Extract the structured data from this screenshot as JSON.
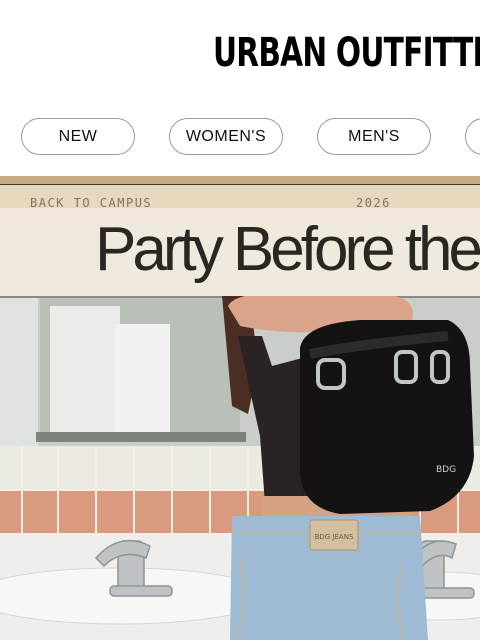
{
  "header": {
    "logo_text": "URBAN OUTFITTERS"
  },
  "nav": {
    "items": [
      {
        "label": "NEW"
      },
      {
        "label": "WOMEN'S"
      },
      {
        "label": "MEN'S"
      },
      {
        "label": ""
      }
    ]
  },
  "hero": {
    "eyebrow_left": "BACK TO CAMPUS",
    "eyebrow_right": "2026",
    "headline": "Party Before the",
    "bag_brand": "BDG",
    "jeans_patch": "BDG JEANS"
  },
  "colors": {
    "banner_tan": "#e7d7bd",
    "headline_band": "#efe8dc",
    "headline_text": "#2a2622",
    "tile_salmon": "#d99a80",
    "top_black": "#1e1a1a"
  }
}
